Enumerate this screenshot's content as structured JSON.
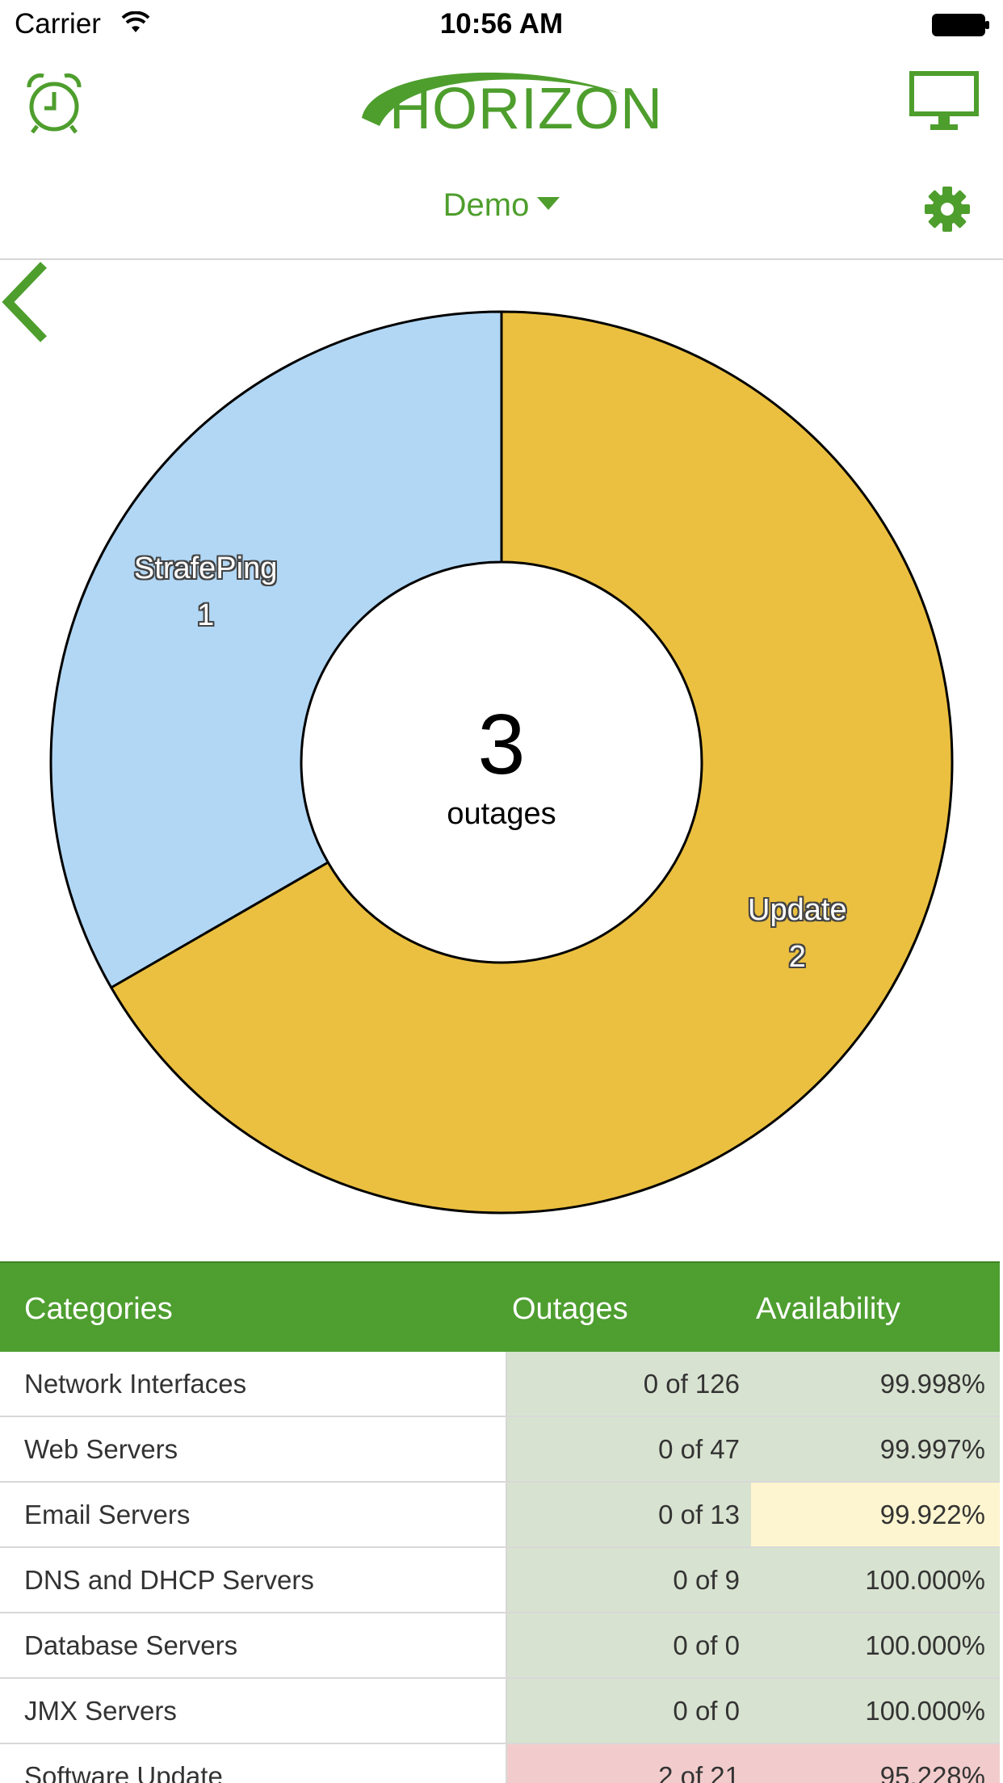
{
  "status_bar": {
    "carrier": "Carrier",
    "time": "10:56 AM"
  },
  "header": {
    "logo_text": "HORIZON",
    "org_selector": "Demo",
    "icons": {
      "left": "alarm-clock-icon",
      "right": "monitor-icon",
      "settings": "gear-icon"
    },
    "accent_color": "#4e9e2d"
  },
  "chart_data": {
    "type": "pie",
    "variant": "donut",
    "center_value": "3",
    "center_label": "outages",
    "slices": [
      {
        "label": "StrafePing",
        "value": 1,
        "color": "#b1d7f5"
      },
      {
        "label": "Update",
        "value": 2,
        "color": "#ebc040"
      }
    ]
  },
  "table": {
    "headers": {
      "category": "Categories",
      "outages": "Outages",
      "availability": "Availability"
    },
    "rows": [
      {
        "category": "Network Interfaces",
        "outages": "0 of 126",
        "availability": "99.998%",
        "outage_status": "green",
        "avail_status": "green"
      },
      {
        "category": "Web Servers",
        "outages": "0 of 47",
        "availability": "99.997%",
        "outage_status": "green",
        "avail_status": "green"
      },
      {
        "category": "Email Servers",
        "outages": "0 of 13",
        "availability": "99.922%",
        "outage_status": "green",
        "avail_status": "yellow"
      },
      {
        "category": "DNS and DHCP Servers",
        "outages": "0 of 9",
        "availability": "100.000%",
        "outage_status": "green",
        "avail_status": "green"
      },
      {
        "category": "Database Servers",
        "outages": "0 of 0",
        "availability": "100.000%",
        "outage_status": "green",
        "avail_status": "green"
      },
      {
        "category": "JMX Servers",
        "outages": "0 of 0",
        "availability": "100.000%",
        "outage_status": "green",
        "avail_status": "green"
      },
      {
        "category": "Software Update",
        "outages": "2 of 21",
        "availability": "95.228%",
        "outage_status": "red",
        "avail_status": "red"
      }
    ]
  }
}
